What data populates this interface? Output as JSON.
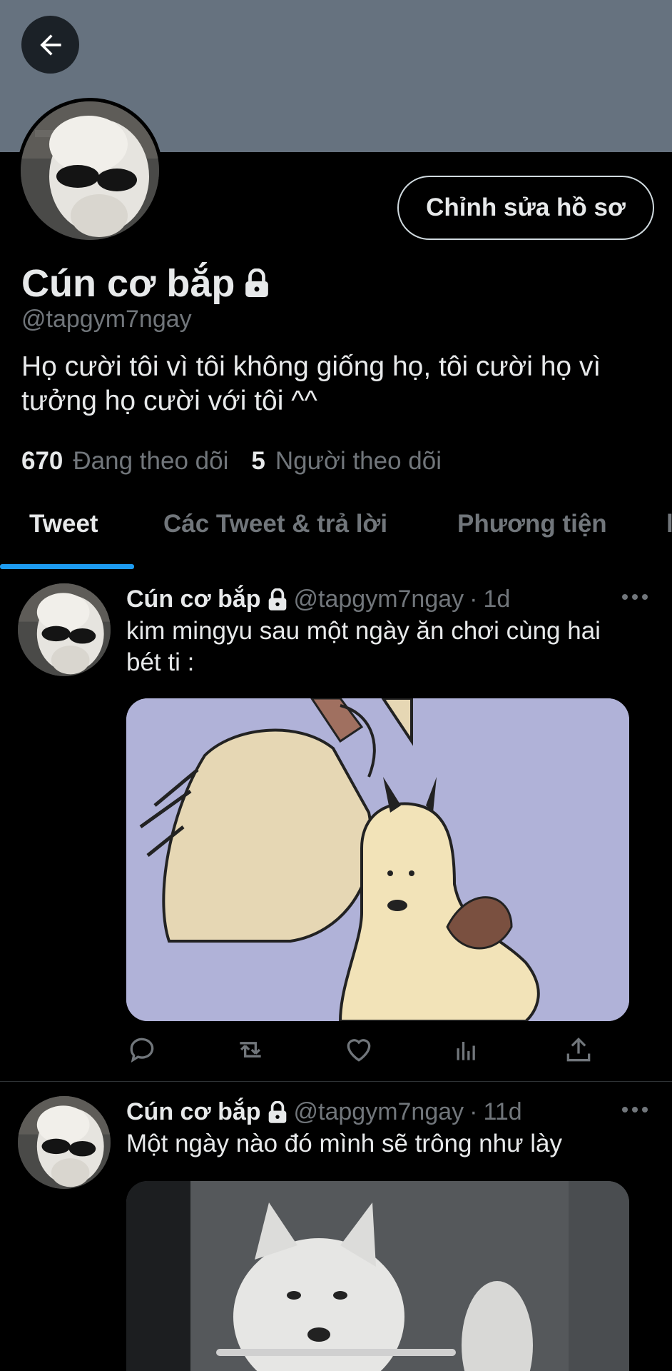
{
  "profile": {
    "edit_label": "Chỉnh sửa hồ sơ",
    "display_name": "Cún cơ bắp",
    "handle": "@tapgym7ngay",
    "bio": "Họ cười tôi vì tôi không giống họ, tôi cười họ vì tưởng họ cười với tôi ^^",
    "following_count": "670",
    "following_label": "Đang theo dõi",
    "followers_count": "5",
    "followers_label": "Người theo dõi"
  },
  "tabs": [
    {
      "label": "Tweet",
      "active": true
    },
    {
      "label": "Các Tweet & trả lời",
      "active": false
    },
    {
      "label": "Phương tiện",
      "active": false
    }
  ],
  "tweets": [
    {
      "name": "Cún cơ bắp",
      "handle": "@tapgym7ngay",
      "sep": "·",
      "time": "1d",
      "text": "kim mingyu sau một ngày ăn chơi cùng hai bét ti :"
    },
    {
      "name": "Cún cơ bắp",
      "handle": "@tapgym7ngay",
      "sep": "·",
      "time": "11d",
      "text": "Một ngày nào đó mình sẽ trông như lày"
    }
  ],
  "icons": {
    "back": "arrow-left-icon",
    "lock": "lock-icon",
    "more": "more-horizontal-icon",
    "reply": "reply-icon",
    "retweet": "retweet-icon",
    "like": "heart-icon",
    "views": "analytics-icon",
    "share": "share-icon"
  },
  "colors": {
    "banner": "#66727f",
    "accent": "#1d9bf0",
    "background": "#000000",
    "muted_text": "#71767b"
  }
}
